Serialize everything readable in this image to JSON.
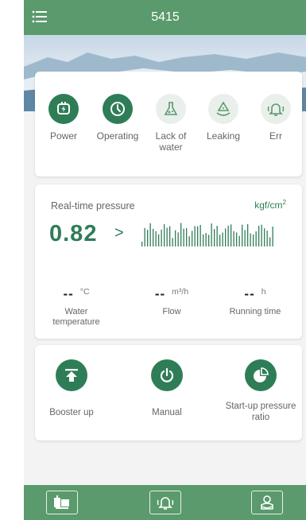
{
  "header": {
    "title": "5415",
    "menu_icon": "menu-icon"
  },
  "status": {
    "items": [
      {
        "label": "Power",
        "icon": "plug-icon",
        "active": true
      },
      {
        "label": "Operating",
        "icon": "timer-icon",
        "active": true
      },
      {
        "label": "Lack of water",
        "icon": "flask-icon",
        "active": false
      },
      {
        "label": "Leaking",
        "icon": "drop-warning-icon",
        "active": false
      },
      {
        "label": "Err",
        "icon": "bell-alarm-icon",
        "active": false
      }
    ]
  },
  "pressure": {
    "label": "Real-time pressure",
    "unit": "kgf/cm",
    "unit_sup": "2",
    "value": "0.82",
    "arrow": ">"
  },
  "metrics": [
    {
      "value": "--",
      "unit": "°C",
      "name": "Water temperature"
    },
    {
      "value": "--",
      "unit": "m³/h",
      "name": "Flow"
    },
    {
      "value": "--",
      "unit": "h",
      "name": "Running time"
    }
  ],
  "actions": [
    {
      "label": "Booster up",
      "icon": "arrow-up-icon"
    },
    {
      "label": "Manual",
      "icon": "power-icon"
    },
    {
      "label": "Start-up pressure ratio",
      "icon": "pie-chart-icon"
    }
  ],
  "bottom_tabs": [
    {
      "icon": "pump-icon"
    },
    {
      "icon": "bell-icon"
    },
    {
      "icon": "user-icon"
    }
  ],
  "colors": {
    "primary": "#2f7d57",
    "bar": "#5a9a6c",
    "inactive_icon_bg": "#e9efea"
  }
}
